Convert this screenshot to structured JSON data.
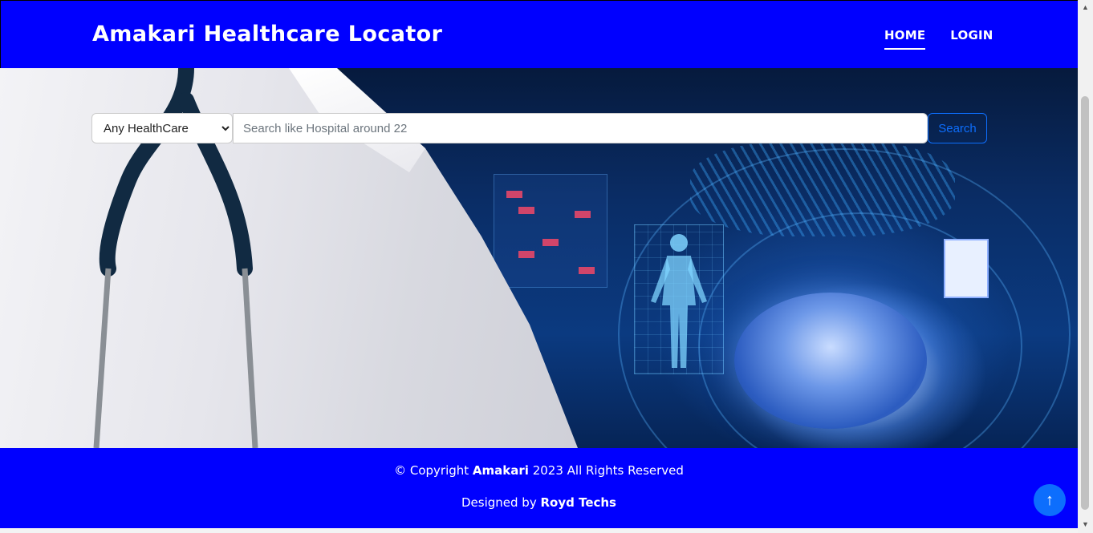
{
  "header": {
    "brand": "Amakari Healthcare Locator",
    "nav": [
      {
        "label": "HOME",
        "active": true
      },
      {
        "label": "LOGIN",
        "active": false
      }
    ]
  },
  "search": {
    "category_selected": "Any HealthCare",
    "placeholder": "Search like Hospital around 22",
    "value": "",
    "button_label": "Search"
  },
  "footer": {
    "copyright_prefix": "© Copyright",
    "company": "Amakari",
    "copyright_suffix": "2023 All Rights Reserved",
    "designed_by_prefix": "Designed by",
    "designer": "Royd Techs"
  },
  "back_to_top": {
    "icon": "arrow-up-icon",
    "glyph": "↑"
  },
  "colors": {
    "brand_blue": "#0000ff",
    "accent": "#0d6efd"
  }
}
